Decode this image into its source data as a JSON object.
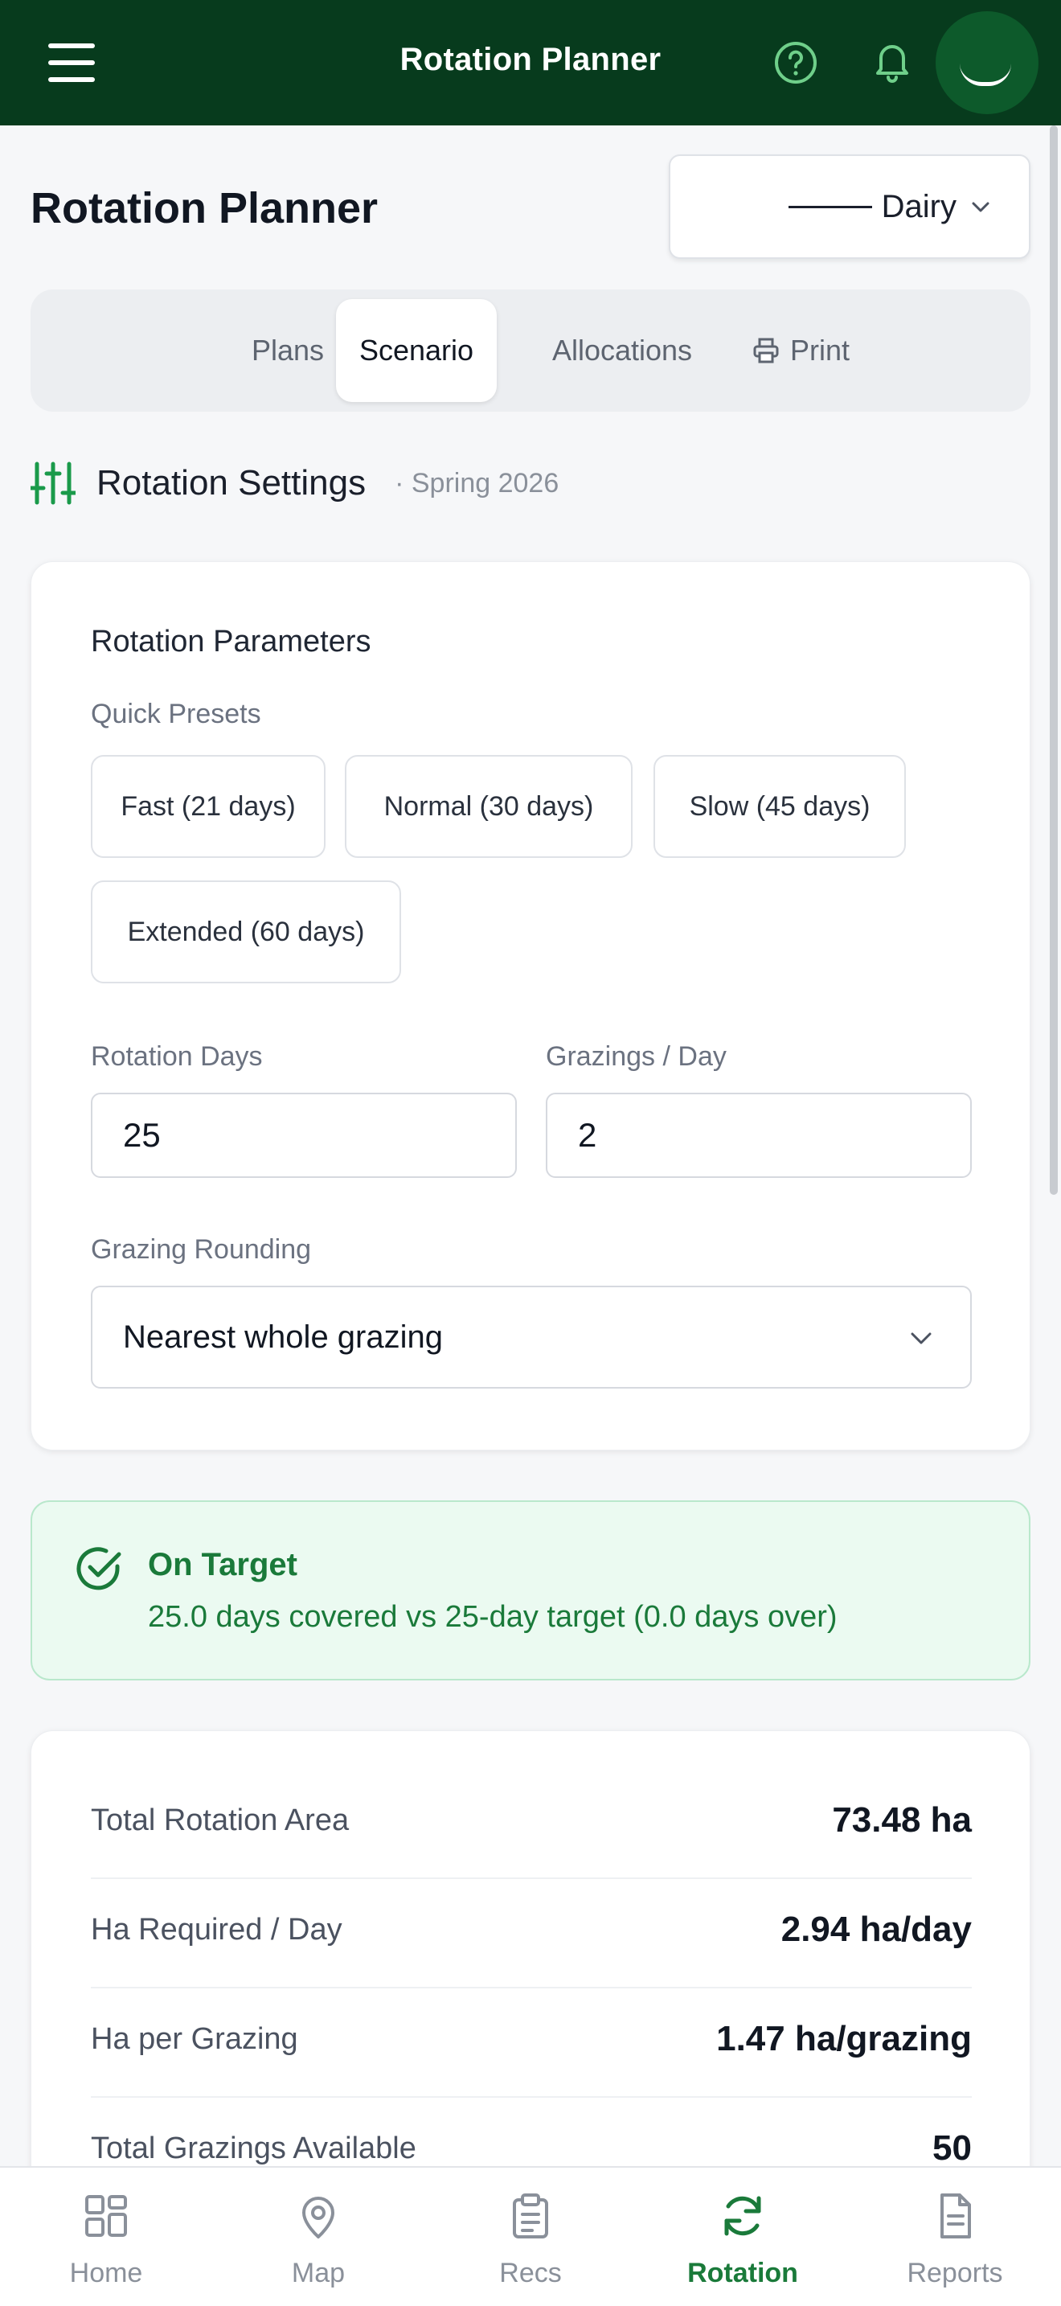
{
  "appbar": {
    "title": "Rotation Planner",
    "icons": [
      "menu-icon",
      "help-icon",
      "bell-icon",
      "avatar"
    ]
  },
  "header": {
    "page_title": "Rotation Planner",
    "farm_selector": "Dairy"
  },
  "tabs": [
    {
      "label": "Plans",
      "active": false
    },
    {
      "label": "Scenario",
      "active": true
    },
    {
      "label": "Allocations",
      "active": false
    },
    {
      "label": "Print",
      "active": false
    }
  ],
  "section": {
    "title": "Rotation Settings",
    "subtitle": "· Spring 2026"
  },
  "params": {
    "card_title": "Rotation Parameters",
    "presets_label": "Quick Presets",
    "presets": [
      "Fast (21 days)",
      "Normal (30 days)",
      "Slow (45 days)",
      "Extended (60 days)"
    ],
    "rotation_days_label": "Rotation Days",
    "rotation_days_value": "25",
    "grazings_label": "Grazings / Day",
    "grazings_value": "2",
    "rounding_label": "Grazing Rounding",
    "rounding_value": "Nearest whole grazing"
  },
  "status": {
    "title": "On Target",
    "message": "25.0 days covered vs 25-day target (0.0 days over)"
  },
  "summary": [
    {
      "label": "Total Rotation Area",
      "value": "73.48 ha"
    },
    {
      "label": "Ha Required / Day",
      "value": "2.94 ha/day"
    },
    {
      "label": "Ha per Grazing",
      "value": "1.47 ha/grazing"
    },
    {
      "label": "Total Grazings Available",
      "value": "50"
    }
  ],
  "bottom_nav": [
    {
      "label": "Home",
      "icon": "home-grid-icon",
      "active": false
    },
    {
      "label": "Map",
      "icon": "map-pin-icon",
      "active": false
    },
    {
      "label": "Recs",
      "icon": "clipboard-icon",
      "active": false
    },
    {
      "label": "Rotation",
      "icon": "rotation-icon",
      "active": true
    },
    {
      "label": "Reports",
      "icon": "report-icon",
      "active": false
    }
  ],
  "colors": {
    "appbar": "#073b1d",
    "accent": "#1a7a3a",
    "status_bg": "#ebfaf1"
  }
}
